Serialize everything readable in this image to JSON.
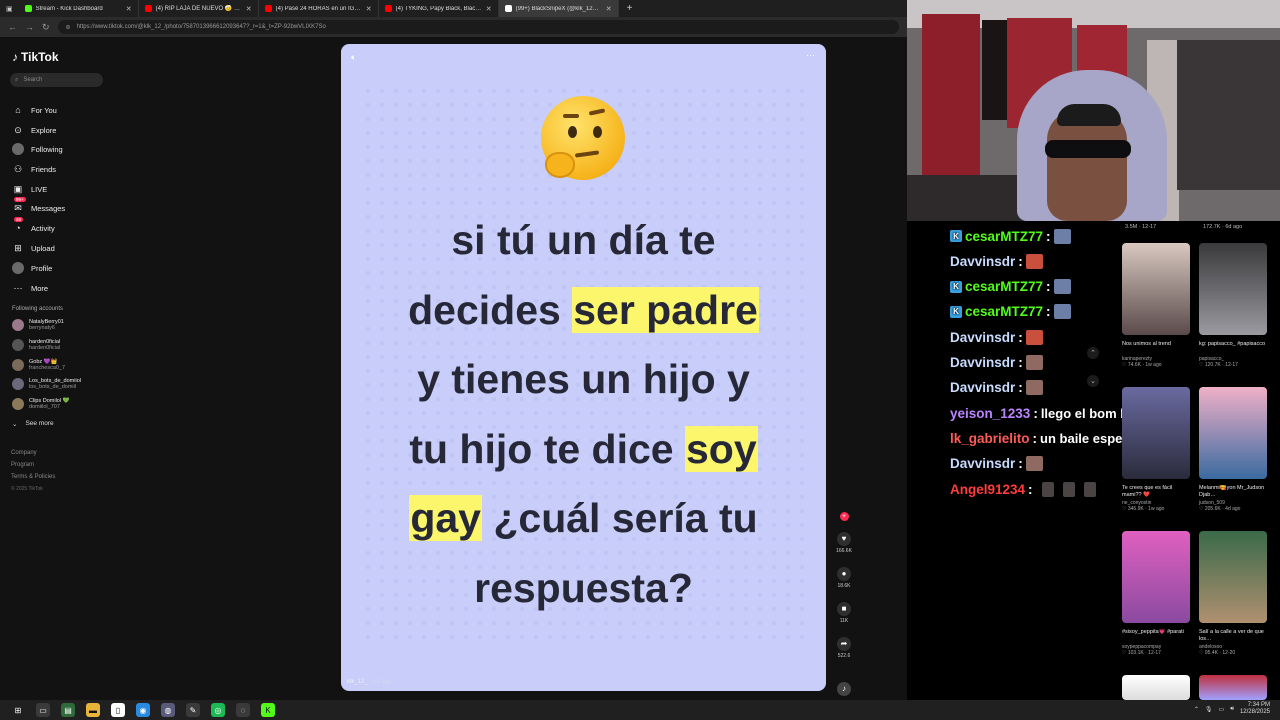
{
  "browser": {
    "tabs": [
      {
        "title": "Stream - Kick Dashboard",
        "color": "#53fc18",
        "active": false
      },
      {
        "title": "(4) RIP LAJA DE NUEVO 🤕 DOMI",
        "color": "#ff0000",
        "active": false
      },
      {
        "title": "(4) Pasé 24 HORAS en un IGLÚ He",
        "color": "#ff0000",
        "active": false
      },
      {
        "title": "(4) TYKING, Papy Black, Blacky Dr",
        "color": "#ff0000",
        "active": false
      },
      {
        "title": "(99+) BlackSnipeX (@klk_12_) vid",
        "color": "#ffffff",
        "active": true
      }
    ],
    "new_tab": "+",
    "url": "https://www.tiktok.com/@klk_12_/photo/7587013966612093647?_r=1&_t=ZP-92bwVLIXK7So"
  },
  "tiktok": {
    "logo": "TikTok",
    "search_placeholder": "Search",
    "nav": [
      {
        "label": "For You",
        "icon": "⌂",
        "icon_name": "home-icon"
      },
      {
        "label": "Explore",
        "icon": "⊙",
        "icon_name": "compass-icon"
      },
      {
        "label": "Following",
        "icon": "",
        "icon_name": "following-icon",
        "circle": true
      },
      {
        "label": "Friends",
        "icon": "⚇",
        "icon_name": "friends-icon"
      },
      {
        "label": "LIVE",
        "icon": "▣",
        "icon_name": "live-icon"
      },
      {
        "label": "Messages",
        "icon": "✉",
        "icon_name": "messages-icon",
        "badge": "99+"
      },
      {
        "label": "Activity",
        "icon": "◔",
        "icon_name": "activity-icon",
        "badge": "46"
      },
      {
        "label": "Upload",
        "icon": "⊞",
        "icon_name": "upload-icon"
      },
      {
        "label": "Profile",
        "icon": "",
        "icon_name": "profile-icon",
        "circle": true
      },
      {
        "label": "More",
        "icon": "⋯",
        "icon_name": "more-icon"
      }
    ],
    "following_header": "Following accounts",
    "accounts": [
      {
        "name": "NatalyBerry01",
        "handle": "berrynaty6"
      },
      {
        "name": "harden0ficial",
        "handle": "harden0ficial"
      },
      {
        "name": "Gobz 💜👑",
        "handle": "franchesca0_7"
      },
      {
        "name": "Los_bots_de_domiiol",
        "handle": "los_bots_de_domiil"
      },
      {
        "name": "Clips Domilol 💚",
        "handle": "domiilol_707"
      }
    ],
    "see_more": "See more",
    "footer": [
      "Company",
      "Program",
      "Terms & Policies"
    ],
    "copyright": "© 2025 TikTok"
  },
  "video": {
    "caption_lines": [
      [
        {
          "t": "si tú un día te",
          "h": false
        }
      ],
      [
        {
          "t": "decides ",
          "h": false
        },
        {
          "t": "ser padre",
          "h": true
        }
      ],
      [
        {
          "t": "y tienes un hijo y",
          "h": false
        }
      ],
      [
        {
          "t": "tu hijo te dice ",
          "h": false
        },
        {
          "t": "soy",
          "h": true
        }
      ],
      [
        {
          "t": "gay",
          "h": true
        },
        {
          "t": " ¿cuál sería tu",
          "h": false
        }
      ],
      [
        {
          "t": "respuesta?",
          "h": false
        }
      ]
    ],
    "user": "klk_12_",
    "time_ago": "5d ago",
    "actions": [
      {
        "name": "like",
        "icon": "♥",
        "count": "166.6K"
      },
      {
        "name": "comment",
        "icon": "●",
        "count": "18.6K"
      },
      {
        "name": "save",
        "icon": "■",
        "count": "11K"
      },
      {
        "name": "share",
        "icon": "➦",
        "count": "522.6"
      }
    ]
  },
  "chat": [
    {
      "user": "cesarMTZ77",
      "color": "#53fc18",
      "badge": true,
      "emote": "blue",
      "text": ""
    },
    {
      "user": "Davvinsdr",
      "color": "#c8dcff",
      "badge": false,
      "emote": "red",
      "text": ""
    },
    {
      "user": "cesarMTZ77",
      "color": "#53fc18",
      "badge": true,
      "emote": "blue",
      "text": ""
    },
    {
      "user": "cesarMTZ77",
      "color": "#53fc18",
      "badge": true,
      "emote": "blue",
      "text": ""
    },
    {
      "user": "Davvinsdr",
      "color": "#c8dcff",
      "badge": false,
      "emote": "red",
      "text": ""
    },
    {
      "user": "Davvinsdr",
      "color": "#c8dcff",
      "badge": false,
      "emote": "",
      "text": ""
    },
    {
      "user": "Davvinsdr",
      "color": "#c8dcff",
      "badge": false,
      "emote": "",
      "text": ""
    },
    {
      "user": "yeison_1233",
      "color": "#b985ff",
      "badge": false,
      "emote": "none",
      "text": "llego el bom bom"
    },
    {
      "user": "lk_gabrielito",
      "color": "#ff5a5a",
      "badge": false,
      "emote": "none",
      "text": "un baile especial"
    },
    {
      "user": "Davvinsdr",
      "color": "#c8dcff",
      "badge": false,
      "emote": "",
      "text": ""
    },
    {
      "user": "Angel91234",
      "color": "#ff3b3b",
      "badge": false,
      "emote": "triple",
      "text": ""
    }
  ],
  "suggested_top_meta": [
    {
      "left": "3.5M · 12-17",
      "x": "a"
    },
    {
      "left": "172.7K · 6d ago",
      "x": "b"
    }
  ],
  "suggested": [
    {
      "title": "Nos unimos al trend",
      "author": "karinaperezty",
      "meta": "♡ 74.6K · 1w ago",
      "c1": "#d8c8c0",
      "c2": "#5a4a4a"
    },
    {
      "title": "kg: papisacco_ #papisacco",
      "author": "papisacco_",
      "meta": "♡ 120.7K · 12-17",
      "c1": "#3a3a3c",
      "c2": "#9a9aa0"
    },
    {
      "title": "Te crees que es fácil mami?? ❤️",
      "author": "ne_conyostin",
      "meta": "♡ 346.9K · 1w ago",
      "c1": "#6a6aa0",
      "c2": "#2b2b3c"
    },
    {
      "title": "Melanmi🥰yon Mr_Judson Djab…",
      "author": "judson_509",
      "meta": "♡ 205.6K · 4d ago",
      "c1": "#f0b0c8",
      "c2": "#3a6aa0"
    },
    {
      "title": "#sisoy_peppita💗 #parati",
      "author": "soypeppacompay",
      "meta": "♡ 103.1K · 12-17",
      "c1": "#e060c0",
      "c2": "#8a4aa0"
    },
    {
      "title": "Salí a la calle a ver de que los…",
      "author": "andelosoo",
      "meta": "♡ 95.4K · 12-20",
      "c1": "#3a6a4a",
      "c2": "#b09070"
    },
    {
      "title": "",
      "author": "",
      "meta": "",
      "c1": "#ffffff",
      "c2": "#dddddd"
    },
    {
      "title": "",
      "author": "",
      "meta": "",
      "c1": "#c03040",
      "c2": "#a0a0ff"
    }
  ],
  "taskbar": {
    "clock_time": "7:34 PM",
    "clock_date": "12/28/2025",
    "apps": [
      {
        "name": "start-icon",
        "color": "transparent",
        "glyph": "⊞"
      },
      {
        "name": "search-app-icon",
        "color": "#3a3a3a",
        "glyph": "▭"
      },
      {
        "name": "terminal-icon",
        "color": "#2f6a3a",
        "glyph": "▤"
      },
      {
        "name": "folder-icon",
        "color": "#e8b43a",
        "glyph": "▬"
      },
      {
        "name": "file-icon",
        "color": "#ffffff",
        "glyph": "▯"
      },
      {
        "name": "chrome-icon",
        "color": "#2a8ae0",
        "glyph": "◉"
      },
      {
        "name": "obs-icon",
        "color": "#5a5a7a",
        "glyph": "◍"
      },
      {
        "name": "app-icon",
        "color": "#3a3a3a",
        "glyph": "✎"
      },
      {
        "name": "spotify-icon",
        "color": "#1db954",
        "glyph": "◎"
      },
      {
        "name": "browser-icon",
        "color": "#3a3a3a",
        "glyph": "◌"
      },
      {
        "name": "kick-icon",
        "color": "#53fc18",
        "glyph": "K"
      }
    ]
  }
}
